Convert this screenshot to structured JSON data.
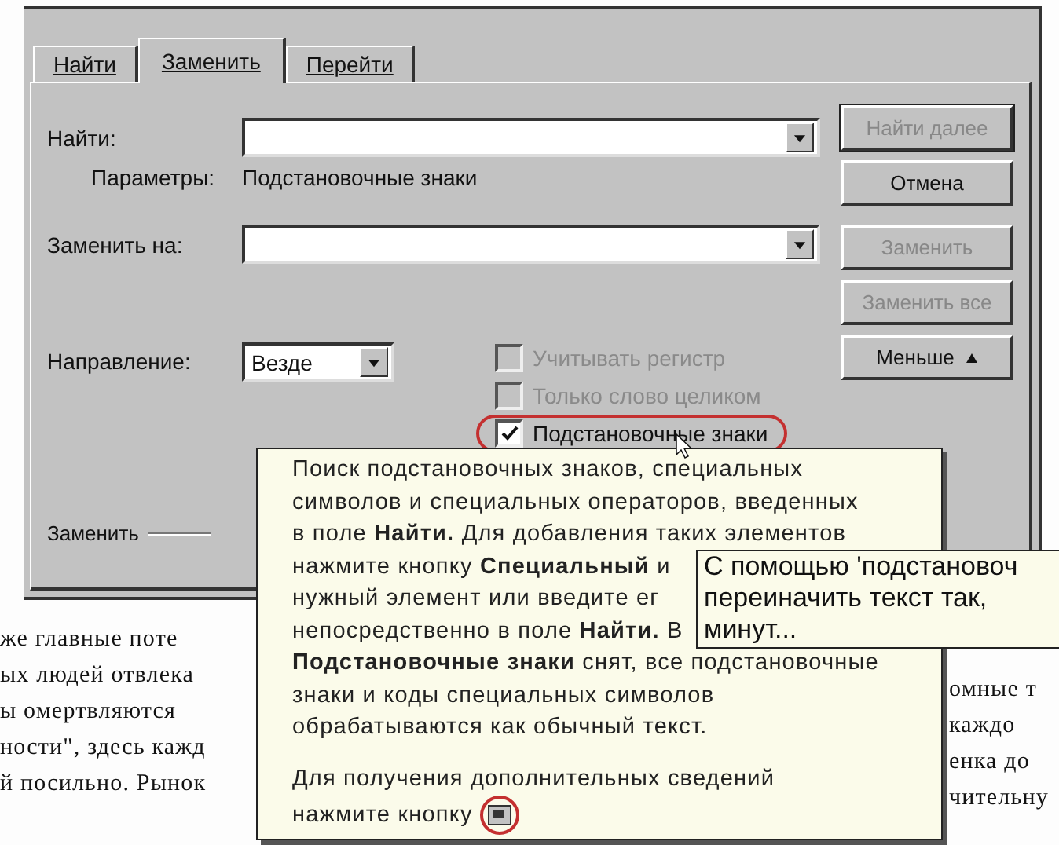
{
  "document": {
    "left_lines": [
      "же главные поте",
      "ых людей отвлека",
      "ы омертвляются",
      "ности\", здесь кажд",
      "й посильно. Рынок"
    ],
    "right_lines": [
      "омные т",
      "каждо",
      "енка до",
      "чительну"
    ]
  },
  "dialog": {
    "tabs": [
      {
        "label": "Найти",
        "selected": false
      },
      {
        "label": "Заменить",
        "selected": true
      },
      {
        "label": "Перейти",
        "selected": false
      }
    ],
    "find_label": "Найти:",
    "params_label": "Параметры:",
    "params_value": "Подстановочные знаки",
    "replace_label": "Заменить на:",
    "direction_label": "Направление:",
    "direction_value": "Везде",
    "buttons": [
      {
        "label": "Найти далее",
        "disabled": true
      },
      {
        "label": "Отмена",
        "disabled": false
      },
      {
        "label": "Заменить",
        "disabled": true
      },
      {
        "label": "Заменить все",
        "disabled": true
      },
      {
        "label": "Меньше",
        "disabled": false
      }
    ],
    "options": [
      {
        "label": "Учитывать регистр",
        "checked": false,
        "disabled": true,
        "highlighted": false
      },
      {
        "label": "Только слово целиком",
        "checked": false,
        "disabled": true,
        "highlighted": false
      },
      {
        "label": "Подстановочные знаки",
        "checked": true,
        "disabled": false,
        "highlighted": true
      }
    ],
    "section_label": "Заменить"
  },
  "tooltip": {
    "lines": [
      "Поиск подстановочных знаков, специальных",
      "символов и специальных операторов, введенных",
      "в поле **Найти.** Для добавления таких элементов",
      "нажмите кнопку **Специальный** и",
      "нужный элемент или введите ег",
      "непосредственно в поле **Найти.** В",
      "**Подстановочные знаки** снят, все подстановочные",
      "знаки и коды специальных символов",
      "обрабатываются как обычный текст."
    ],
    "footer_lines": [
      "Для получения дополнительных сведений",
      "нажмите кнопку"
    ]
  },
  "popup": {
    "lines": [
      "С помощью 'подстановоч",
      "переиначить текст так,",
      "минут..."
    ]
  }
}
